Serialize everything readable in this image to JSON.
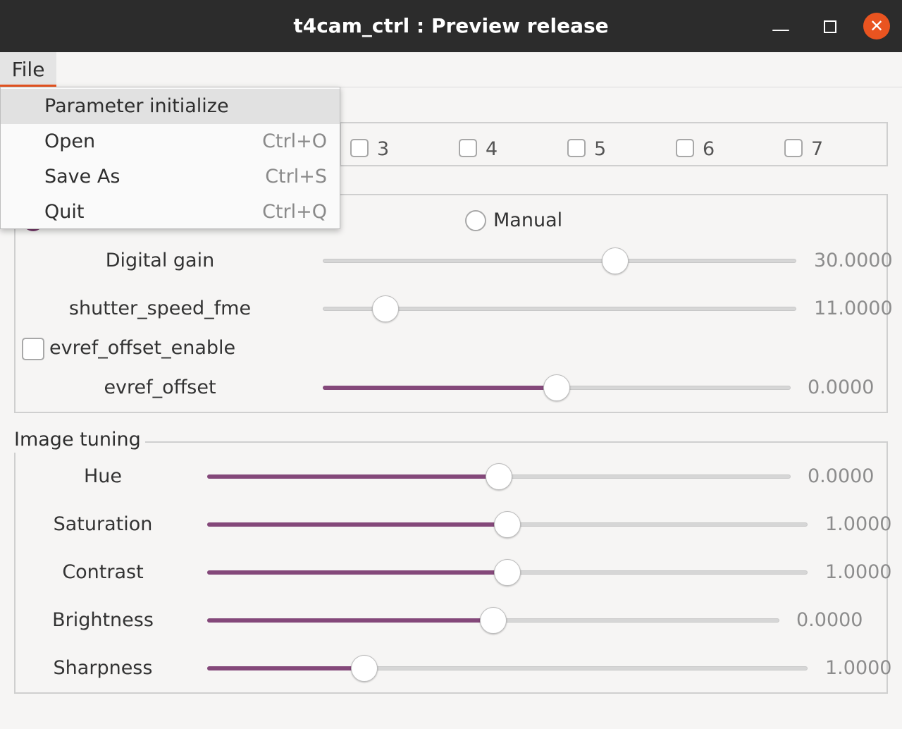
{
  "window": {
    "title": "t4cam_ctrl : Preview release"
  },
  "menubar": {
    "file": "File"
  },
  "file_menu": [
    {
      "label": "Parameter initialize",
      "shortcut": ""
    },
    {
      "label": "Open",
      "shortcut": "Ctrl+O"
    },
    {
      "label": "Save As",
      "shortcut": "Ctrl+S"
    },
    {
      "label": "Quit",
      "shortcut": "Ctrl+Q"
    }
  ],
  "camera_checkboxes": [
    "3",
    "4",
    "5",
    "6",
    "7"
  ],
  "exposure": {
    "manual_label": "Manual",
    "digital_gain": {
      "label": "Digital gain",
      "value": "30.0000",
      "fraction": 0.625
    },
    "shutter_speed": {
      "label": "shutter_speed_fme",
      "value": "11.0000",
      "fraction": 0.11
    },
    "evref_offset_enable": {
      "label": "evref_offset_enable",
      "checked": false
    },
    "evref_offset": {
      "label": "evref_offset",
      "value": "0.0000",
      "fraction": 0.5
    }
  },
  "image_tuning": {
    "title": "Image tuning",
    "sliders": [
      {
        "label": "Hue",
        "value": "0.0000",
        "fraction": 0.5
      },
      {
        "label": "Saturation",
        "value": "1.0000",
        "fraction": 0.5
      },
      {
        "label": "Contrast",
        "value": "1.0000",
        "fraction": 0.5
      },
      {
        "label": "Brightness",
        "value": "0.0000",
        "fraction": 0.5
      },
      {
        "label": "Sharpness",
        "value": "1.0000",
        "fraction": 0.25
      }
    ]
  },
  "colors": {
    "accent": "#84487a",
    "close": "#e95420",
    "titlebar": "#2c2c2c"
  }
}
